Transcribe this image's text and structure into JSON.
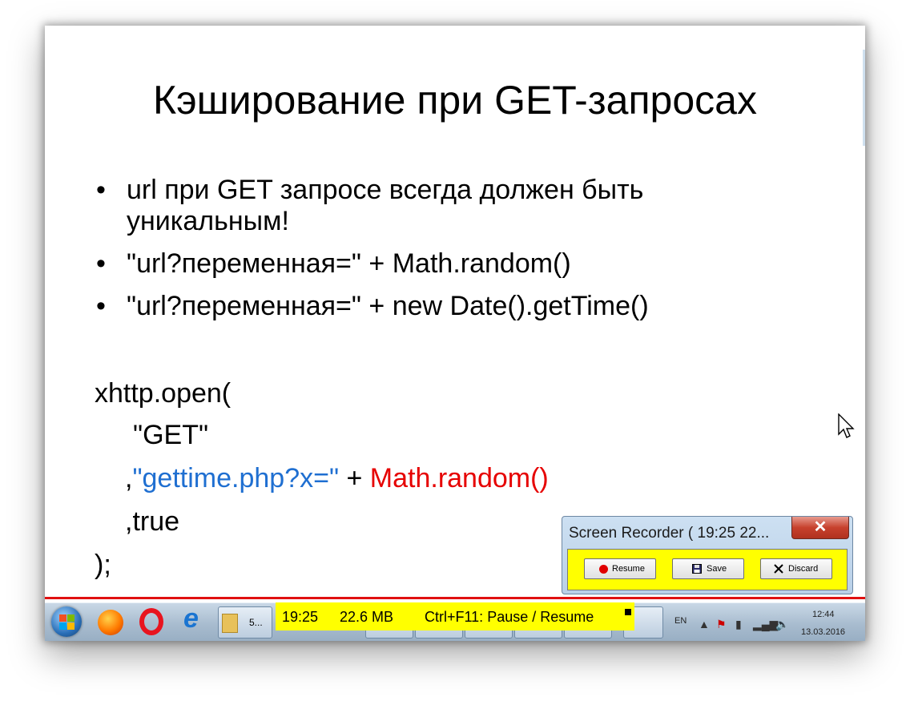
{
  "slide": {
    "title": "Кэширование при GET-запросах",
    "bullets": [
      {
        "line1": "url при GET запросе всегда должен быть",
        "line2": "уникальным!"
      },
      {
        "line1": "\"url?переменная=\" + Math.random()"
      },
      {
        "line1": "\"url?переменная=\" + new Date().getTime()"
      }
    ],
    "code": {
      "open": "xhttp.open(",
      "method": "\"GET\"",
      "url_comma": ",",
      "url_string": "\"gettime.php?x=\"",
      "url_plus": " + ",
      "url_random": "Math.random()",
      "async": ",true",
      "close": ");"
    },
    "colors": {
      "code_string": "#1f6fd1",
      "code_random": "#e60000",
      "rule": "#e01010"
    }
  },
  "bullet_char": "•",
  "recording_bar": {
    "time": "19:25",
    "size": "22.6 MB",
    "hint": "Ctrl+F11: Pause / Resume",
    "background": "#ffff00"
  },
  "recorder_window": {
    "title": "Screen Recorder ( 19:25   22...",
    "close_label": "✕",
    "buttons": {
      "resume": "Resume",
      "save": "Save",
      "discard": "Discard"
    }
  },
  "taskbar": {
    "items": [
      {
        "icon": "start-orb"
      },
      {
        "icon": "firefox-icon"
      },
      {
        "icon": "opera-icon",
        "glyph": "O"
      },
      {
        "icon": "ie-icon",
        "glyph": "e"
      },
      {
        "icon": "folder-icon",
        "label": "5..."
      }
    ],
    "tray": {
      "lang": "EN",
      "time": "12:44",
      "date": "13.03.2016"
    }
  }
}
